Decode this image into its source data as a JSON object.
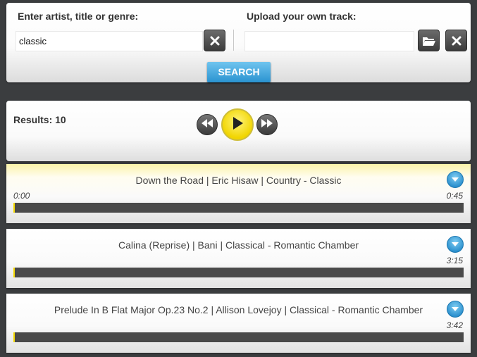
{
  "search": {
    "artist_label": "Enter artist, title or genre:",
    "artist_value": "classic",
    "upload_label": "Upload your own track:",
    "upload_value": "",
    "search_button": "SEARCH"
  },
  "results": {
    "label": "Results: 10"
  },
  "colors": {
    "accent_blue": "#2a93d0",
    "play_yellow": "#f1d500",
    "progress_track": "#4a4a4a",
    "background": "#3b3d3f"
  },
  "tracks": [
    {
      "title": "Down the Road | Eric Hisaw | Country - Classic",
      "start": "0:00",
      "end": "0:45",
      "active": true,
      "progress": 0.003
    },
    {
      "title": "Calina (Reprise) | Bani | Classical - Romantic Chamber",
      "start": "",
      "end": "3:15",
      "active": false,
      "progress": 0.003
    },
    {
      "title": "Prelude In B Flat Major Op.23 No.2 | Allison Lovejoy | Classical - Romantic Chamber",
      "start": "",
      "end": "3:42",
      "active": false,
      "progress": 0.003
    }
  ]
}
